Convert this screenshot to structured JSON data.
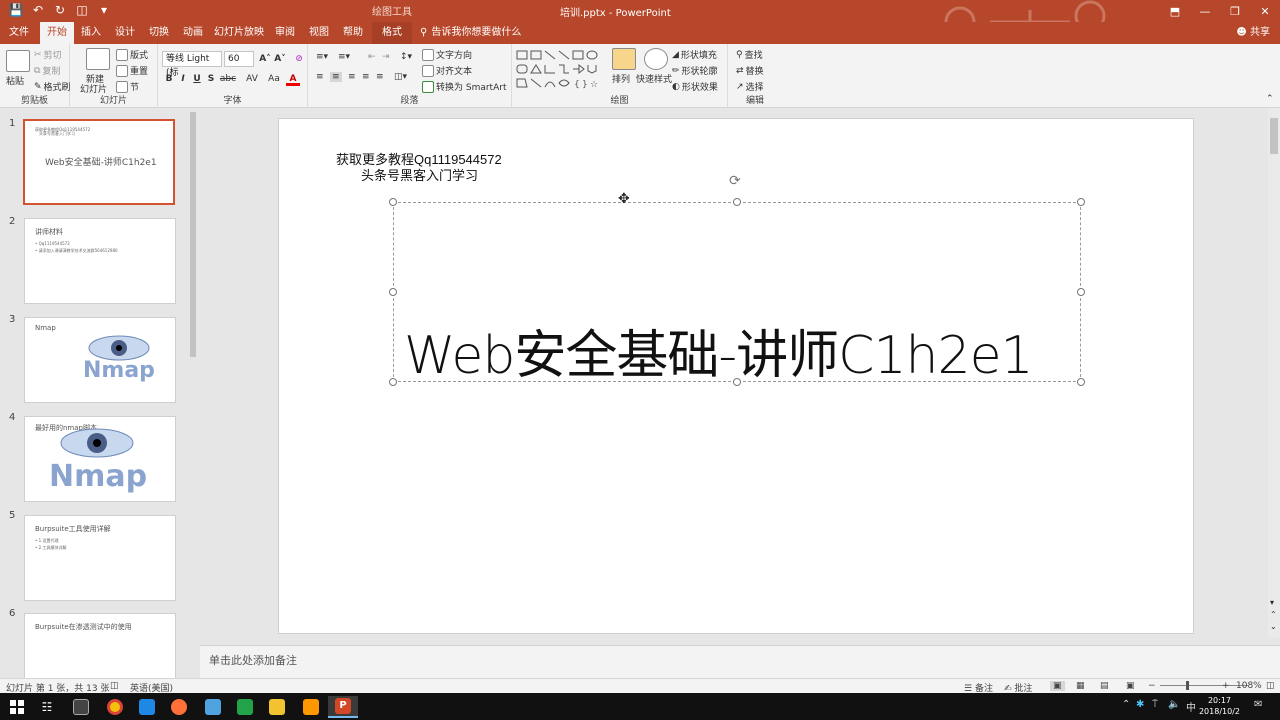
{
  "window": {
    "doc_title": "培训.pptx  -  PowerPoint",
    "context_tab_label": "绘图工具",
    "minimize": "—",
    "restore": "❐",
    "close": "✕",
    "ribbon_display": "⬒"
  },
  "tabs": [
    {
      "label": "文件"
    },
    {
      "label": "开始"
    },
    {
      "label": "插入"
    },
    {
      "label": "设计"
    },
    {
      "label": "切换"
    },
    {
      "label": "动画"
    },
    {
      "label": "幻灯片放映"
    },
    {
      "label": "审阅"
    },
    {
      "label": "视图"
    },
    {
      "label": "帮助"
    },
    {
      "label": "格式"
    }
  ],
  "tell_me": "告诉我你想要做什么",
  "share": "共享",
  "ribbon": {
    "clipboard": {
      "paste": "粘贴",
      "cut": "剪切",
      "copy": "复制",
      "format_painter": "格式刷",
      "label": "剪贴板"
    },
    "slides": {
      "new_slide": "新建\n幻灯片",
      "new_slide_a": "新建",
      "new_slide_b": "幻灯片",
      "layout": "版式",
      "reset": "重置",
      "section": "节",
      "label": "幻灯片"
    },
    "font": {
      "font_name": "等线 Light (标",
      "font_size": "60",
      "label": "字体",
      "bold": "B",
      "italic": "I",
      "underline": "U",
      "shadow": "S",
      "strike": "abc",
      "spacing": "AV",
      "case": "Aa",
      "color": "A"
    },
    "paragraph": {
      "text_direction": "文字方向",
      "align_text": "对齐文本",
      "smartart": "转换为 SmartArt",
      "label": "段落"
    },
    "drawing": {
      "arrange": "排列",
      "quick_styles": "快速样式",
      "fill": "形状填充",
      "outline": "形状轮廓",
      "effects": "形状效果",
      "label": "绘图"
    },
    "editing": {
      "find": "查找",
      "replace": "替换",
      "select": "选择",
      "label": "编辑"
    }
  },
  "thumbnails": [
    {
      "num": "1",
      "title": "Web安全基础-讲师C1h2e1",
      "lines": [
        "获取更多教程Qq1119544572",
        "头条号黑客入门学习"
      ]
    },
    {
      "num": "2",
      "title": "讲师材料",
      "lines": [
        "• Qq1119544572",
        "• 请添加入课请演教学技术交流群564612980"
      ]
    },
    {
      "num": "3",
      "title": "Nmap",
      "logo": "Nmap"
    },
    {
      "num": "4",
      "title": "最好用的nmap脚本",
      "logo": "Nmap"
    },
    {
      "num": "5",
      "title": "Burpsuite工具使用详解",
      "lines": [
        "• 1.设置代理",
        "• 2.工具模块详解"
      ]
    },
    {
      "num": "6",
      "title": "Burpsuite在渗透测试中的使用",
      "lines": []
    }
  ],
  "slide": {
    "header_line1": "获取更多教程Qq1119544572",
    "header_line2": "头条号黑客入门学习",
    "title": "Web安全基础-讲师C1h2e1"
  },
  "notes_placeholder": "单击此处添加备注",
  "status": {
    "slide_info": "幻灯片 第 1 张，共 13 张",
    "language": "英语(美国)",
    "notes": "备注",
    "comments": "批注",
    "zoom": "108%",
    "zoom_minus": "−",
    "zoom_plus": "+"
  },
  "taskbar": {
    "time": "20:17",
    "date": "2018/10/2",
    "ime": "中",
    "apps": [
      {
        "name": "start",
        "color": "#ffffff"
      },
      {
        "name": "task-view",
        "color": "#cccccc"
      },
      {
        "name": "terminal",
        "color": "#444444"
      },
      {
        "name": "chrome",
        "color": "#f4c20d"
      },
      {
        "name": "app-blue",
        "color": "#1e88e5"
      },
      {
        "name": "firefox",
        "color": "#ff7139"
      },
      {
        "name": "app-download",
        "color": "#4fa3e0"
      },
      {
        "name": "app-green",
        "color": "#22a34a"
      },
      {
        "name": "app-notes",
        "color": "#f2c230"
      },
      {
        "name": "sublime",
        "color": "#ff9800"
      },
      {
        "name": "powerpoint",
        "color": "#d24726"
      }
    ]
  },
  "colors": {
    "accent": "#b7472a",
    "selection_border": "#d35230"
  }
}
